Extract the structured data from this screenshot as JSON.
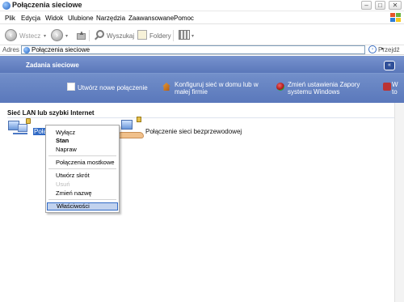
{
  "window": {
    "title": "Połączenia sieciowe",
    "min_label": "–",
    "max_label": "□",
    "close_label": "✕"
  },
  "menubar": {
    "items": [
      "Plik",
      "Edycja",
      "Widok",
      "Ulubione",
      "Narzędzia",
      "Zaawansowane",
      "Pomoc"
    ]
  },
  "toolbar": {
    "back_label": "Wstecz",
    "forward_arrow": "›",
    "back_arrow": "‹",
    "search_label": "Wyszukaj",
    "folders_label": "Foldery",
    "dropdown": "▾"
  },
  "address": {
    "label": "Adres",
    "value": "Połączenia sieciowe",
    "go_label": "Przejdź",
    "go_arrow": "›",
    "drop_arrow": "▾"
  },
  "taskpane": {
    "title": "Zadania sieciowe",
    "collapse_label": "«",
    "tasks": [
      {
        "line1": "Utwórz nowe połączenie",
        "line2": ""
      },
      {
        "line1": "Konfiguruj sieć w domu lub w",
        "line2": "małej firmie"
      },
      {
        "line1": "Zmień ustawienia Zapory",
        "line2": "systemu Windows"
      },
      {
        "line1": "W",
        "line2": "to"
      }
    ]
  },
  "content": {
    "group_title": "Sieć LAN lub szybki Internet",
    "lan_label": "Połą",
    "wifi_label": "Połączenie sieci bezprzewodowej"
  },
  "context_menu": {
    "items": [
      {
        "label": "Wyłącz",
        "state": "normal"
      },
      {
        "label": "Stan",
        "state": "bold"
      },
      {
        "label": "Napraw",
        "state": "normal"
      },
      {
        "label": "Połączenia mostkowe",
        "state": "normal"
      },
      {
        "label": "Utwórz skrót",
        "state": "normal"
      },
      {
        "label": "Usuń",
        "state": "disabled"
      },
      {
        "label": "Zmień nazwę",
        "state": "normal"
      },
      {
        "label": "Właściwości",
        "state": "selected"
      }
    ]
  },
  "colors": {
    "taskpane": "#6f8cc8",
    "selection": "#316ac5",
    "menu_highlight": "#c1d2ee"
  }
}
